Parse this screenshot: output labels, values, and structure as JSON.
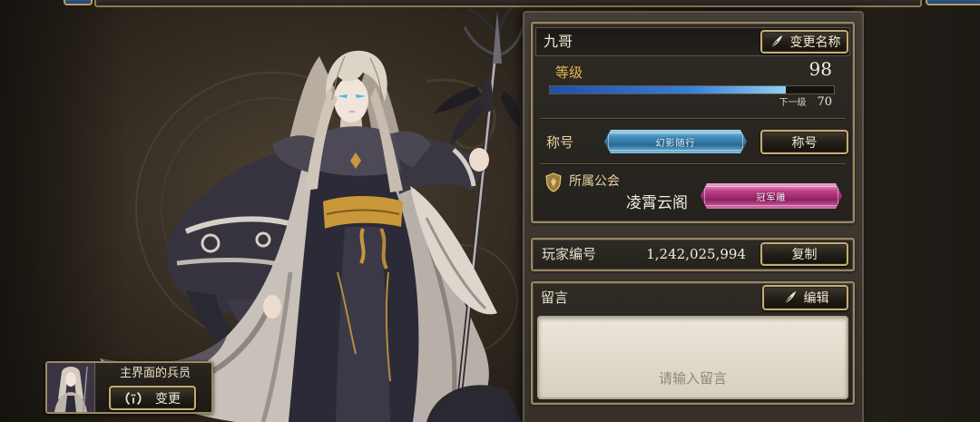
{
  "profile": {
    "name": "九哥",
    "rename_label": "变更名称",
    "level_label": "等级",
    "level": "98",
    "level_progress": 0.83,
    "next_level_label": "下一级",
    "next_level_value": "70",
    "title_label": "称号",
    "title_badge": "幻影随行",
    "title_button_label": "称号",
    "guild_label": "所属公会",
    "guild_name": "凌霄云阁",
    "guild_badge": "冠军雕"
  },
  "player_id": {
    "label": "玩家编号",
    "value": "1,242,025,994",
    "copy_label": "复制"
  },
  "message": {
    "label": "留言",
    "edit_label": "编辑",
    "placeholder": "请输入留言"
  },
  "main_unit": {
    "label": "主界面的兵员",
    "change_label": "变更"
  },
  "icons": {
    "rename": "quill-icon",
    "edit": "quill-icon",
    "guild": "guild-shield-icon",
    "change_unit": "swap-icon"
  },
  "colors": {
    "gold_accent": "#c4ad74",
    "level_label": "#e9b84c",
    "progress_fill": "#8fd0f2",
    "title_badge": "#468fbc",
    "guild_badge": "#bd4289"
  }
}
